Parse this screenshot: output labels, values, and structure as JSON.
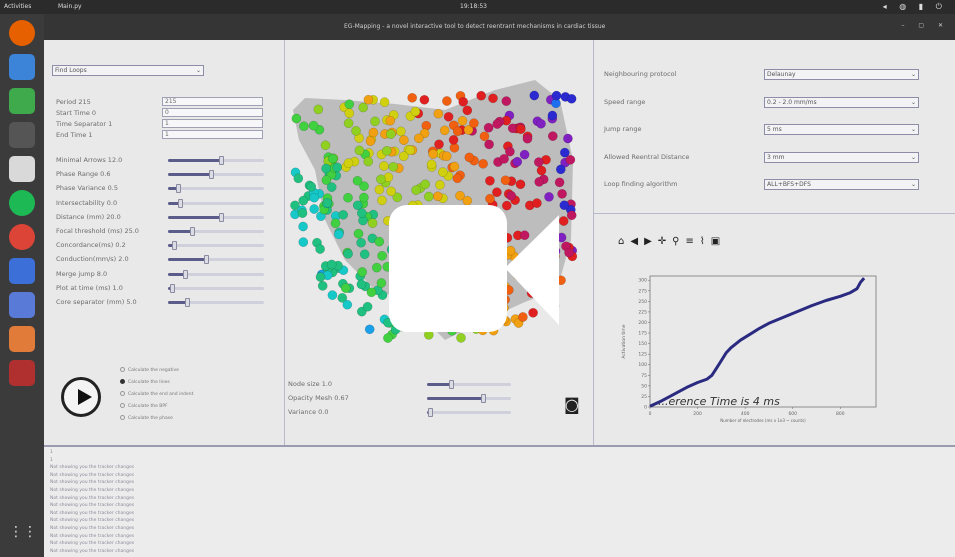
{
  "topbar": {
    "activities": "Activities",
    "app": "Main.py",
    "clock": "19:18:53"
  },
  "window": {
    "title": "EG-Mapping - a novel interactive tool to detect reentrant mechanisms in cardiac tissue"
  },
  "left": {
    "mode_select": "Find Loops",
    "text_params": [
      {
        "label": "Period 215",
        "value": "215"
      },
      {
        "label": "Start Time 0",
        "value": "0"
      },
      {
        "label": "Time Separator 1",
        "value": "1"
      },
      {
        "label": "End Time 1",
        "value": "1"
      }
    ],
    "sliders": [
      {
        "label": "Minimal Arrows 12.0",
        "level": 0.55
      },
      {
        "label": "Phase Range 0.6",
        "level": 0.45
      },
      {
        "label": "Phase Variance 0.5",
        "level": 0.1
      },
      {
        "label": "Intersectability 0.0",
        "level": 0.12
      },
      {
        "label": "Distance (mm) 20.0",
        "level": 0.55
      },
      {
        "label": "Focal threshold (ms) 25.0",
        "level": 0.25
      },
      {
        "label": "Concordance(ms) 0.2",
        "level": 0.06
      },
      {
        "label": "Conduction(mm/s) 2.0",
        "level": 0.4
      },
      {
        "label": "Merge jump 8.0",
        "level": 0.18
      },
      {
        "label": "Plot at time (ms) 1.0",
        "level": 0.04
      },
      {
        "label": "Core separator (mm) 5.0",
        "level": 0.2
      }
    ],
    "radios": [
      {
        "label": "Calculate the negative",
        "on": false
      },
      {
        "label": "Calculate the lines",
        "on": true
      },
      {
        "label": "Calculate the end and indent",
        "on": false
      },
      {
        "label": "Calculate the BPF",
        "on": false
      },
      {
        "label": "Calculate the phase",
        "on": false
      }
    ]
  },
  "center": {
    "sliders": [
      {
        "label": "Node size 1.0",
        "level": 0.28
      },
      {
        "label": "Opacity Mesh 0.67",
        "level": 0.67
      },
      {
        "label": "Variance 0.0",
        "level": 0.03
      }
    ]
  },
  "right": {
    "settings": [
      {
        "label": "Neighbouring protocol",
        "value": "Delaunay"
      },
      {
        "label": "Speed range",
        "value": "0.2 - 2.0 mm/ms"
      },
      {
        "label": "Jump range",
        "value": "5 ms"
      },
      {
        "label": "Allowed Reentral Distance",
        "value": "3 mm"
      },
      {
        "label": "Loop finding algorithm",
        "value": "ALL+BFS+DFS"
      }
    ],
    "toolbar_icons": [
      "home-icon",
      "back-icon",
      "forward-icon",
      "pan-icon",
      "zoom-icon",
      "subplots-icon",
      "lines-icon",
      "save-icon"
    ],
    "toolbar_glyphs": [
      "⌂",
      "◀",
      "▶",
      "✛",
      "⚲",
      "≡",
      "⌇",
      "▣"
    ]
  },
  "chart_data": {
    "type": "line",
    "title": "",
    "annotation": "...erence Time is 4 ms",
    "xlabel": "Number of electrodes (ms x 1e3 ~ counts)",
    "ylabel": "Activation time",
    "xlim": [
      0,
      950
    ],
    "ylim": [
      0,
      310
    ],
    "xticks": [
      0,
      200,
      400,
      600,
      800
    ],
    "yticks": [
      0,
      25,
      50,
      75,
      100,
      125,
      150,
      175,
      200,
      225,
      250,
      275,
      300
    ],
    "x": [
      0,
      40,
      80,
      120,
      160,
      200,
      240,
      260,
      280,
      300,
      320,
      340,
      380,
      420,
      460,
      500,
      560,
      620,
      680,
      740,
      800,
      840,
      870,
      885,
      900
    ],
    "y": [
      2,
      12,
      24,
      36,
      48,
      58,
      66,
      75,
      92,
      110,
      128,
      140,
      158,
      172,
      186,
      198,
      212,
      226,
      240,
      252,
      262,
      270,
      280,
      295,
      305
    ],
    "grid": false,
    "line_color": "#2a2a80"
  },
  "console": {
    "lines": [
      "1",
      "1",
      "Not showing you the tracker changes",
      "Not showing you the tracker changes",
      "Not showing you the tracker changes",
      "Not showing you the tracker changes",
      "Not showing you the tracker changes",
      "Not showing you the tracker changes",
      "Not showing you the tracker changes",
      "Not showing you the tracker changes",
      "Not showing you the tracker changes",
      "Not showing you the tracker changes",
      "Not showing you the tracker changes",
      "Not showing you the tracker changes"
    ]
  },
  "colors": {
    "accent": "#5c5c8a",
    "plot_line": "#2a2a80",
    "dock": "#3b3b3b",
    "titlebar": "#353535"
  }
}
